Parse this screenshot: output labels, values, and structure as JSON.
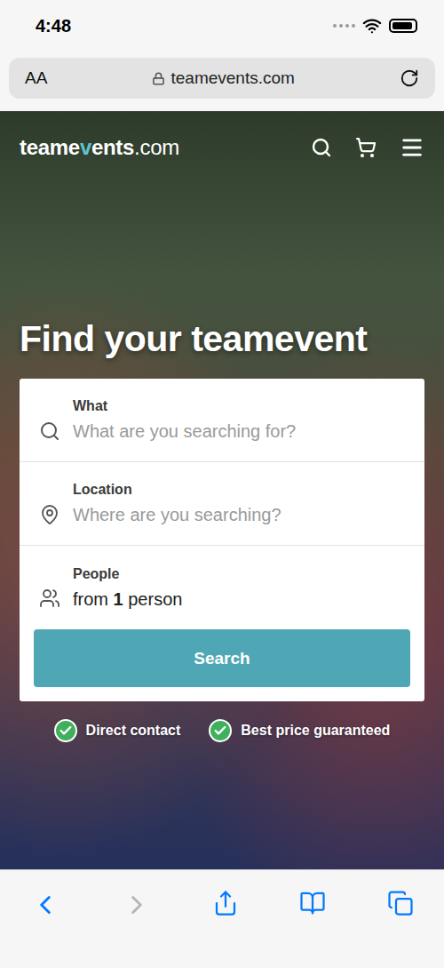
{
  "status_bar": {
    "time": "4:48",
    "battery_level": 0.9
  },
  "browser": {
    "text_size_button": "AA",
    "url": "teamevents.com",
    "secure": true
  },
  "nav": {
    "logo": {
      "prefix": "teame",
      "accent": "v",
      "suffix": "ents",
      "tld": ".com"
    }
  },
  "hero": {
    "title": "Find your teamevent"
  },
  "search_form": {
    "fields": [
      {
        "kind": "search",
        "label": "What",
        "placeholder": "What are you searching for?"
      },
      {
        "kind": "location",
        "label": "Location",
        "placeholder": "Where are you searching?"
      },
      {
        "kind": "people",
        "label": "People",
        "value": {
          "prefix": "from",
          "count": "1",
          "suffix": "person"
        }
      }
    ],
    "button": "Search"
  },
  "badges": [
    {
      "label": "Direct contact"
    },
    {
      "label": "Best price guaranteed"
    }
  ],
  "toolbar": {
    "back_enabled": true,
    "forward_enabled": false
  }
}
